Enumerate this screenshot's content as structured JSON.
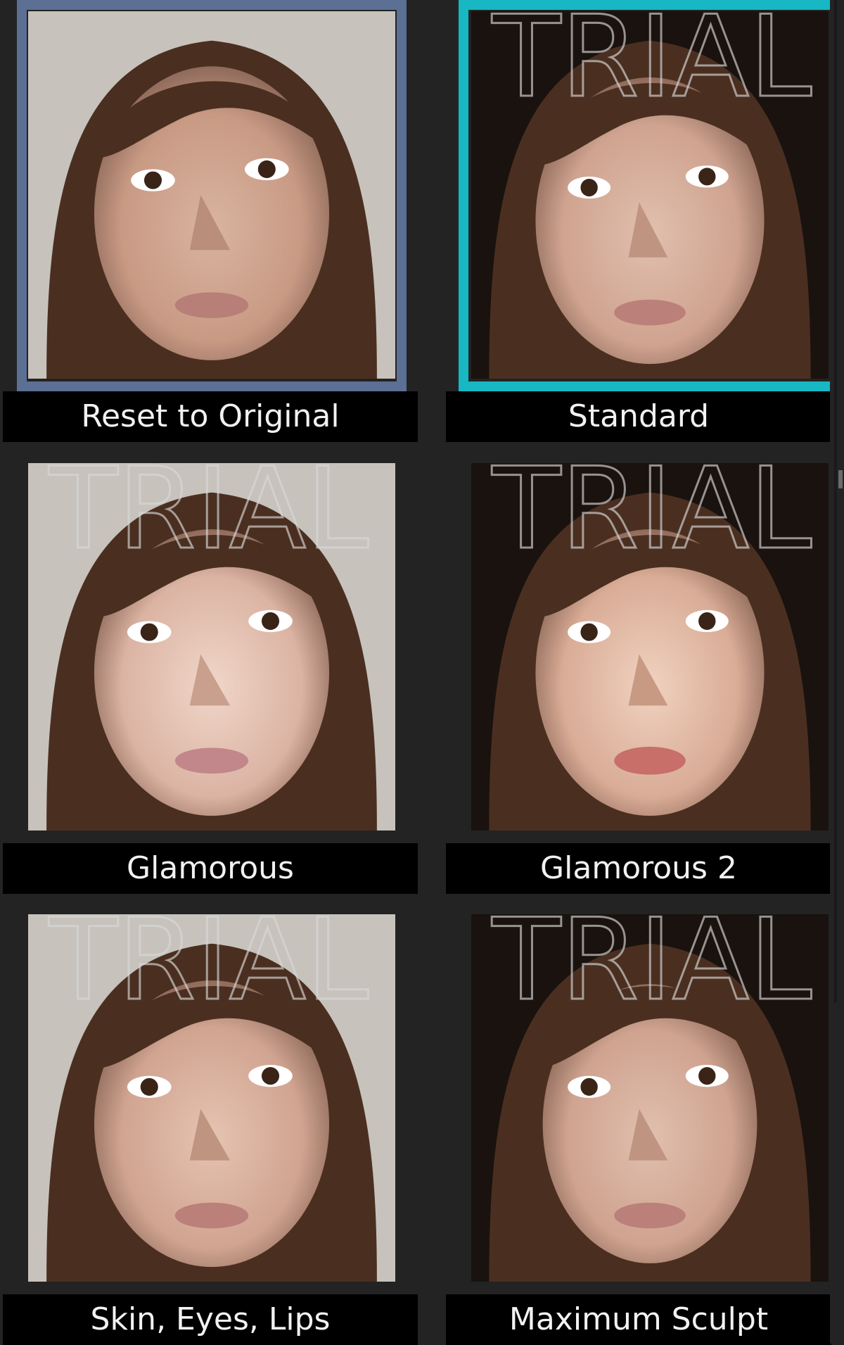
{
  "presets": [
    {
      "label": "Reset to Original",
      "state": "original",
      "watermark": ""
    },
    {
      "label": "Standard",
      "state": "active",
      "watermark": "TRIAL"
    },
    {
      "label": "Glamorous",
      "state": "none",
      "watermark": "TRIAL"
    },
    {
      "label": "Glamorous 2",
      "state": "none",
      "watermark": "TRIAL"
    },
    {
      "label": "Skin, Eyes, Lips",
      "state": "none",
      "watermark": "TRIAL"
    },
    {
      "label": "Maximum Sculpt",
      "state": "none",
      "watermark": "TRIAL"
    }
  ],
  "colors": {
    "background": "#232323",
    "original_frame": "#5c6f94",
    "active_frame": "#17b7c4",
    "label_bar": "#000000",
    "label_text": "#f2f2f2"
  }
}
